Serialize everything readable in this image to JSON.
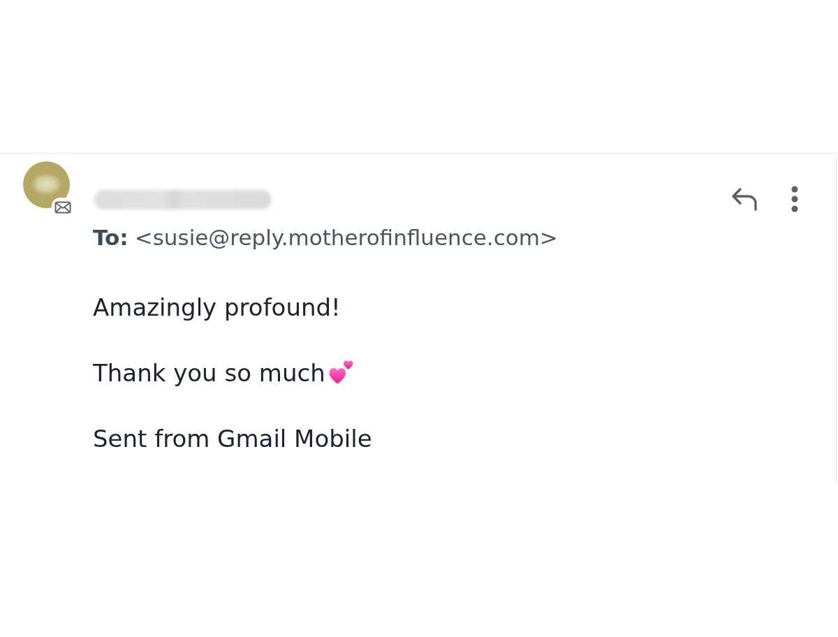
{
  "message": {
    "sender": {
      "name_redacted": true
    },
    "to": {
      "label": "To:",
      "address": "<susie@reply.motherofinfluence.com>"
    },
    "body": [
      {
        "text": "Amazingly profound!",
        "trailing_emoji": false
      },
      {
        "text": "Thank you so much",
        "trailing_emoji": true
      },
      {
        "text": "Sent from Gmail Mobile",
        "trailing_emoji": false
      }
    ]
  }
}
